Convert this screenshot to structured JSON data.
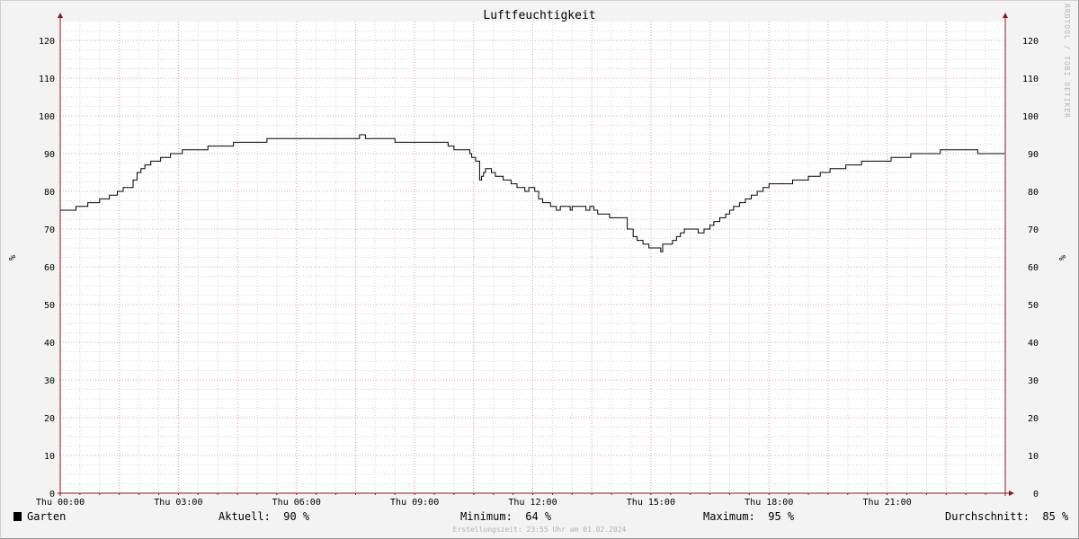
{
  "chart_data": {
    "type": "line",
    "title": "Luftfeuchtigkeit",
    "ylabel": "%",
    "ylim": [
      0,
      125
    ],
    "xlim_hours": [
      0,
      24
    ],
    "y_ticks": [
      0,
      10,
      20,
      30,
      40,
      50,
      60,
      70,
      80,
      90,
      100,
      110,
      120
    ],
    "x_ticks": [
      {
        "hour": 0,
        "label": "Thu 00:00"
      },
      {
        "hour": 3,
        "label": "Thu 03:00"
      },
      {
        "hour": 6,
        "label": "Thu 06:00"
      },
      {
        "hour": 9,
        "label": "Thu 09:00"
      },
      {
        "hour": 12,
        "label": "Thu 12:00"
      },
      {
        "hour": 15,
        "label": "Thu 15:00"
      },
      {
        "hour": 18,
        "label": "Thu 18:00"
      },
      {
        "hour": 21,
        "label": "Thu 21:00"
      }
    ],
    "grid": true,
    "series": [
      {
        "name": "Garten",
        "color": "#000000",
        "step": true,
        "points": [
          [
            0.0,
            75
          ],
          [
            0.4,
            76
          ],
          [
            0.7,
            77
          ],
          [
            1.0,
            78
          ],
          [
            1.25,
            79
          ],
          [
            1.45,
            80
          ],
          [
            1.6,
            81
          ],
          [
            1.85,
            83
          ],
          [
            1.95,
            85
          ],
          [
            2.05,
            86
          ],
          [
            2.15,
            87
          ],
          [
            2.3,
            88
          ],
          [
            2.55,
            89
          ],
          [
            2.8,
            90
          ],
          [
            3.1,
            91
          ],
          [
            3.75,
            92
          ],
          [
            4.4,
            93
          ],
          [
            5.25,
            94
          ],
          [
            7.6,
            95
          ],
          [
            7.75,
            94
          ],
          [
            8.5,
            93
          ],
          [
            9.85,
            92
          ],
          [
            10.0,
            91
          ],
          [
            10.4,
            90
          ],
          [
            10.45,
            89
          ],
          [
            10.55,
            88
          ],
          [
            10.65,
            83
          ],
          [
            10.7,
            84
          ],
          [
            10.75,
            85
          ],
          [
            10.8,
            86
          ],
          [
            10.95,
            85
          ],
          [
            11.05,
            84
          ],
          [
            11.25,
            83
          ],
          [
            11.45,
            82
          ],
          [
            11.6,
            81
          ],
          [
            11.8,
            80
          ],
          [
            11.9,
            81
          ],
          [
            12.05,
            80
          ],
          [
            12.15,
            78
          ],
          [
            12.25,
            77
          ],
          [
            12.45,
            76
          ],
          [
            12.6,
            75
          ],
          [
            12.7,
            76
          ],
          [
            12.95,
            75
          ],
          [
            13.0,
            76
          ],
          [
            13.35,
            75
          ],
          [
            13.45,
            76
          ],
          [
            13.55,
            75
          ],
          [
            13.65,
            74
          ],
          [
            13.95,
            73
          ],
          [
            14.4,
            70
          ],
          [
            14.55,
            68
          ],
          [
            14.65,
            67
          ],
          [
            14.8,
            66
          ],
          [
            14.95,
            65
          ],
          [
            15.25,
            64
          ],
          [
            15.3,
            66
          ],
          [
            15.55,
            67
          ],
          [
            15.65,
            68
          ],
          [
            15.75,
            69
          ],
          [
            15.85,
            70
          ],
          [
            16.2,
            69
          ],
          [
            16.35,
            70
          ],
          [
            16.5,
            71
          ],
          [
            16.6,
            72
          ],
          [
            16.75,
            73
          ],
          [
            16.9,
            74
          ],
          [
            17.0,
            75
          ],
          [
            17.1,
            76
          ],
          [
            17.25,
            77
          ],
          [
            17.4,
            78
          ],
          [
            17.55,
            79
          ],
          [
            17.7,
            80
          ],
          [
            17.85,
            81
          ],
          [
            18.0,
            82
          ],
          [
            18.6,
            83
          ],
          [
            19.0,
            84
          ],
          [
            19.3,
            85
          ],
          [
            19.55,
            86
          ],
          [
            19.95,
            87
          ],
          [
            20.35,
            88
          ],
          [
            21.1,
            89
          ],
          [
            21.6,
            90
          ],
          [
            22.35,
            91
          ],
          [
            23.3,
            90
          ],
          [
            23.65,
            90
          ]
        ]
      }
    ]
  },
  "legend": {
    "series_name": "Garten",
    "aktuell": "Aktuell:  90 %",
    "minimum": "Minimum:  64 %",
    "maximum": "Maximum:  95 %",
    "durchschnitt": "Durchschnitt:  85 %"
  },
  "watermark": "RRDTOOL / TOBI OETIKER",
  "footer": "Erstellungszeit: 23:55 Uhr am 01.02.2024",
  "colors": {
    "background": "#f3f3f3",
    "plot_background": "#ffffff",
    "minor_grid": "#d6d6d6",
    "major_grid": "#e8a0a0",
    "axis": "#8b1a1a",
    "line": "#000000"
  }
}
